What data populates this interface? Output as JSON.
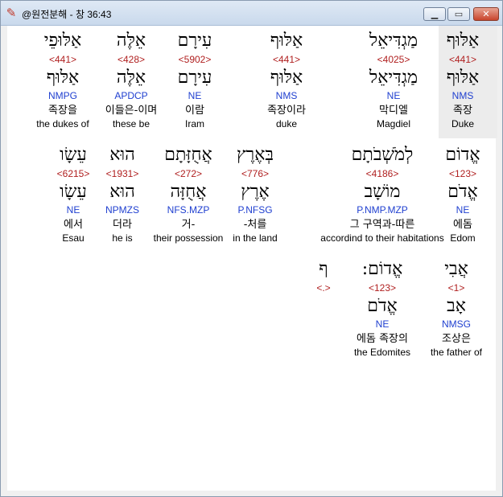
{
  "window": {
    "title": "@원전분해 - 창 36:43",
    "app_icon": "app-book-icon",
    "controls": {
      "minimize": "minimize-icon",
      "maximize": "maximize-icon",
      "close": "close-icon"
    }
  },
  "colors": {
    "number": "#b02020",
    "parsing": "#1f3fd0",
    "highlight": "#ececec"
  },
  "lines": [
    [
      {
        "heb": "אַלּוּף",
        "num": "<441>",
        "lemma": "אַלּוּף",
        "parse": "NMS",
        "kor": "족장",
        "eng": "Duke",
        "selected": true
      },
      {
        "heb": "מַגְדִּיאֵל",
        "num": "<4025>",
        "lemma": "מַגְדִּיאֵל",
        "parse": "NE",
        "kor": "막디엘",
        "eng": "Magdiel"
      },
      {
        "heb": "אַלּוּף",
        "num": "<441>",
        "lemma": "אַלּוּף",
        "parse": "NMS",
        "kor": "족장이라",
        "eng": "duke"
      },
      {
        "heb": "עִירָם",
        "num": "<5902>",
        "lemma": "עִירָם",
        "parse": "NE",
        "kor": "이람",
        "eng": "Iram"
      },
      {
        "heb": "אֵלֶּה",
        "num": "<428>",
        "lemma": "אֵלֶּה",
        "parse": "APDCP",
        "kor": "이들은-이며",
        "eng": "these be"
      },
      {
        "heb": "אַלּוּפֵי",
        "num": "<441>",
        "lemma": "אַלּוּף",
        "parse": "NMPG",
        "kor": "족장을",
        "eng": "the dukes of"
      }
    ],
    [
      {
        "heb": "אֱדוֹם",
        "num": "<123>",
        "lemma": "אֱדֹם",
        "parse": "NE",
        "kor": "에돔",
        "eng": "Edom"
      },
      {
        "heb": "לְמֹשְׁבֹתָם",
        "num": "<4186>",
        "lemma": "מוֹשָׁב",
        "parse": "P.NMP.MZP",
        "kor": "그 구역과-따른",
        "eng": "accordind to their habitations"
      },
      {
        "heb": "בְּאֶרֶץ",
        "num": "<776>",
        "lemma": "אֶרֶץ",
        "parse": "P.NFSG",
        "kor": "-처를",
        "eng": "in the land"
      },
      {
        "heb": "אֲחֻזָּתָם",
        "num": "<272>",
        "lemma": "אֲחֻזָּה",
        "parse": "NFS.MZP",
        "kor": "거-",
        "eng": "their possession"
      },
      {
        "heb": "הוּא",
        "num": "<1931>",
        "lemma": "הוּא",
        "parse": "NPMZS",
        "kor": "더라",
        "eng": "he is"
      },
      {
        "heb": "עֵשָׂו",
        "num": "<6215>",
        "lemma": "עֵשָׂו",
        "parse": "NE",
        "kor": "에서",
        "eng": "Esau"
      }
    ],
    [
      {
        "heb": "אֲבִי",
        "num": "<1>",
        "lemma": "אָב",
        "parse": "NMSG",
        "kor": "조상은",
        "eng": "the father of"
      },
      {
        "heb": "אֱדוֹם:",
        "num": "<123>",
        "lemma": "אֱדֹם",
        "parse": "NE",
        "kor": "에돔 족장의",
        "eng": "the Edomites"
      },
      {
        "heb": "ף",
        "num": "<.>",
        "lemma": "",
        "parse": "",
        "kor": "",
        "eng": ""
      }
    ]
  ]
}
